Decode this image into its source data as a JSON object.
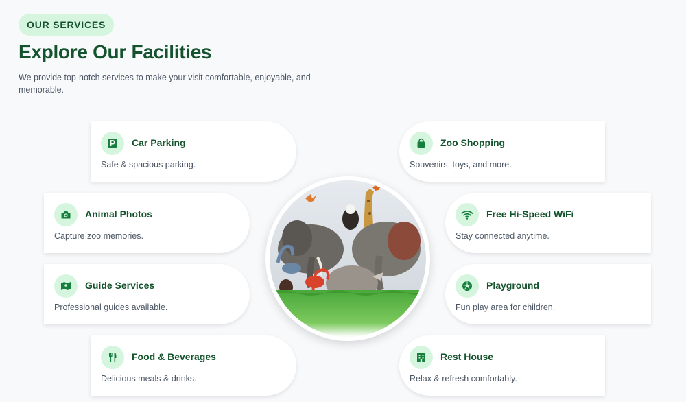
{
  "header": {
    "badge": "OUR SERVICES",
    "title": "Explore Our Facilities",
    "subtitle": "We provide top-notch services to make your visit comfortable, enjoyable, and memorable."
  },
  "services": [
    {
      "title": "Car Parking",
      "desc": "Safe & spacious parking.",
      "icon": "parking-icon"
    },
    {
      "title": "Zoo Shopping",
      "desc": "Souvenirs, toys, and more.",
      "icon": "shopping-bag-icon"
    },
    {
      "title": "Animal Photos",
      "desc": "Capture zoo memories.",
      "icon": "camera-icon"
    },
    {
      "title": "Free Hi-Speed WiFi",
      "desc": "Stay connected anytime.",
      "icon": "wifi-icon"
    },
    {
      "title": "Guide Services",
      "desc": "Professional guides available.",
      "icon": "map-guide-icon"
    },
    {
      "title": "Playground",
      "desc": "Fun play area for children.",
      "icon": "ball-icon"
    },
    {
      "title": "Food & Beverages",
      "desc": "Delicious meals & drinks.",
      "icon": "fork-knife-icon"
    },
    {
      "title": "Rest House",
      "desc": "Relax & refresh comfortably.",
      "icon": "building-icon"
    }
  ],
  "colors": {
    "primary": "#14532d",
    "accent": "#15803d",
    "icon_bg": "#d6f5df",
    "background": "#f8f9fb"
  }
}
